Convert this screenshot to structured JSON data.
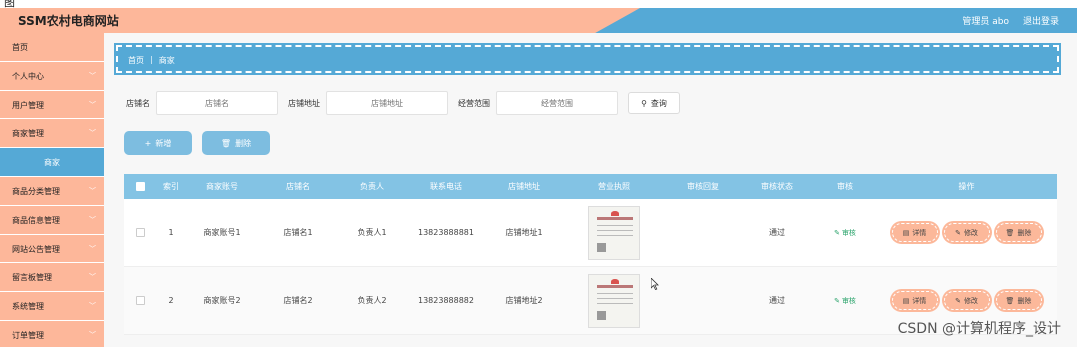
{
  "caption": "图",
  "header": {
    "title": "SSM农村电商网站",
    "admin_label": "管理员 abo",
    "logout_label": "退出登录"
  },
  "sidebar": {
    "items": [
      {
        "label": "首页",
        "has_chevron": false
      },
      {
        "label": "个人中心",
        "has_chevron": true
      },
      {
        "label": "用户管理",
        "has_chevron": true
      },
      {
        "label": "商家管理",
        "has_chevron": true
      },
      {
        "label": "商家",
        "sub": true
      },
      {
        "label": "商品分类管理",
        "has_chevron": true
      },
      {
        "label": "商品信息管理",
        "has_chevron": true
      },
      {
        "label": "网站公告管理",
        "has_chevron": true
      },
      {
        "label": "留言板管理",
        "has_chevron": true
      },
      {
        "label": "系统管理",
        "has_chevron": true
      },
      {
        "label": "订单管理",
        "has_chevron": true
      }
    ]
  },
  "breadcrumb": {
    "home": "首页",
    "separator": "|",
    "current": "商家"
  },
  "search": {
    "shop_name_label": "店铺名",
    "shop_name_placeholder": "店铺名",
    "shop_address_label": "店铺地址",
    "shop_address_placeholder": "店铺地址",
    "scope_label": "经营范围",
    "scope_placeholder": "经营范围",
    "query_button": "查询"
  },
  "actions": {
    "add_label": "新增",
    "delete_label": "删除"
  },
  "table": {
    "headers": {
      "index": "索引",
      "account": "商家账号",
      "shop_name": "店铺名",
      "owner": "负责人",
      "phone": "联系电话",
      "address": "店铺地址",
      "license": "营业执照",
      "reply": "审核回复",
      "status": "审核状态",
      "audit": "审核",
      "ops": "操作"
    },
    "rows": [
      {
        "index": "1",
        "account": "商家账号1",
        "shop_name": "店铺名1",
        "owner": "负责人1",
        "phone": "13823888881",
        "address": "店铺地址1",
        "reply": "",
        "status": "通过",
        "audit": "审核"
      },
      {
        "index": "2",
        "account": "商家账号2",
        "shop_name": "店铺名2",
        "owner": "负责人2",
        "phone": "13823888882",
        "address": "店铺地址2",
        "reply": "",
        "status": "通过",
        "audit": "审核"
      }
    ],
    "op_labels": {
      "detail": "详情",
      "edit": "修改",
      "delete": "删除"
    }
  },
  "watermark": "CSDN @计算机程序_设计",
  "colors": {
    "accent_blue": "#55a9d6",
    "accent_pink": "#fdb79a",
    "table_header": "#83c3e4",
    "audit_green": "#2aa36b"
  }
}
